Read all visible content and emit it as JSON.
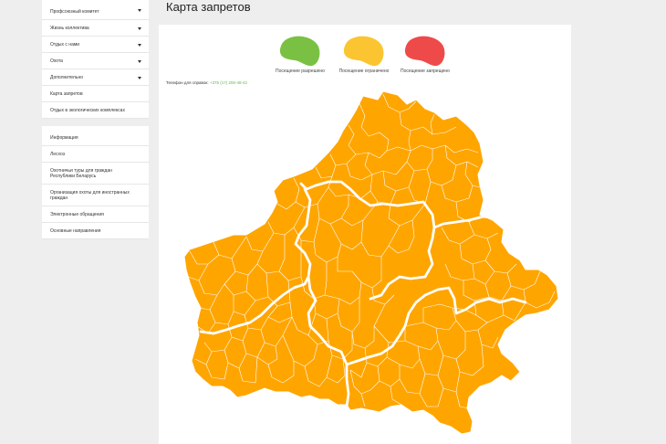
{
  "sidebar": {
    "groups": [
      [
        {
          "label": "Профсоюзный комитет",
          "has_caret": true
        },
        {
          "label": "Жизнь коллектива",
          "has_caret": true
        },
        {
          "label": "Отдых с нами",
          "has_caret": true
        },
        {
          "label": "Охота",
          "has_caret": true
        },
        {
          "label": "Дополнительно",
          "has_caret": true
        },
        {
          "label": "Карта запретов",
          "has_caret": false
        },
        {
          "label": "Отдых в экологических комплексах",
          "has_caret": false
        }
      ],
      [
        {
          "label": "Информация",
          "has_caret": false
        },
        {
          "label": "Лесхоз",
          "has_caret": false
        },
        {
          "label": "Охотничьи туры для граждан Республики Беларусь",
          "has_caret": false
        },
        {
          "label": "Организация охоты для иностранных граждан",
          "has_caret": false
        },
        {
          "label": "Электронные обращения",
          "has_caret": false
        },
        {
          "label": "Основные направления",
          "has_caret": false
        }
      ]
    ]
  },
  "page": {
    "title": "Карта запретов"
  },
  "legend": [
    {
      "label": "Посещение разрешено",
      "color": "#7ac143"
    },
    {
      "label": "Посещение ограничено",
      "color": "#fbc531"
    },
    {
      "label": "Посещение запрещено",
      "color": "#ef4a4a"
    }
  ],
  "contact": {
    "label": "Телефон для справок:",
    "number": "+375 (17) 200-48-42"
  },
  "map": {
    "region_status": "Посещение ограничено",
    "fill": "#ffa500",
    "boundary_color": "#ffffff"
  }
}
